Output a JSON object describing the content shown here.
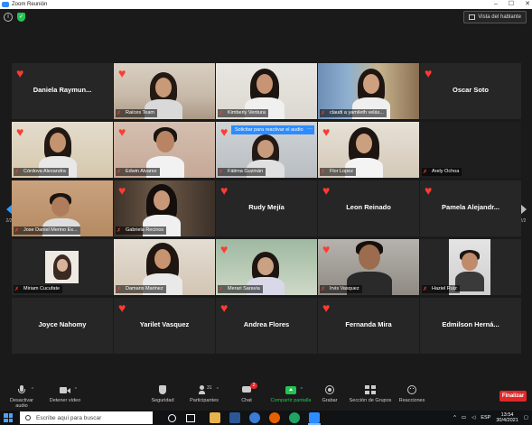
{
  "window": {
    "title": "Zoom Reunión",
    "minimize": "–",
    "maximize": "☐",
    "close": "✕"
  },
  "topbar": {
    "speaker_view_label": "Vista del hablante"
  },
  "nav": {
    "page_left": "2/2",
    "page_right": "2/2"
  },
  "tooltip": {
    "text": "Solicitar para reactivar el audio",
    "more": "···"
  },
  "tiles": [
    {
      "bigname": "Daniela  Raymun...",
      "label": ""
    },
    {
      "bigname": "",
      "label": "Raíces Team"
    },
    {
      "bigname": "",
      "label": "Kimberly Ventura"
    },
    {
      "bigname": "",
      "label": "claudi a yamileth velás..."
    },
    {
      "bigname": "Oscar Soto",
      "label": ""
    },
    {
      "bigname": "",
      "label": "Córdova Alexandra"
    },
    {
      "bigname": "",
      "label": "Edwin Alvarez"
    },
    {
      "bigname": "",
      "label": "Fátima Guzmán"
    },
    {
      "bigname": "",
      "label": "Flor Lopez"
    },
    {
      "bigname": "",
      "label": "Arely Ochoa"
    },
    {
      "bigname": "",
      "label": "Jose Daniel Merino Es..."
    },
    {
      "bigname": "",
      "label": "Gabriela Recinos"
    },
    {
      "bigname": "Rudy Mejía",
      "label": ""
    },
    {
      "bigname": "Leon Reinado",
      "label": ""
    },
    {
      "bigname": "Pamela  Alejandr...",
      "label": ""
    },
    {
      "bigname": "",
      "label": "Miriam Cucufate"
    },
    {
      "bigname": "",
      "label": "Damaris Marinez"
    },
    {
      "bigname": "",
      "label": "Merari Saravia"
    },
    {
      "bigname": "",
      "label": "Irvis Vasquez"
    },
    {
      "bigname": "",
      "label": "Haziel Ruiz"
    },
    {
      "bigname": "Joyce Nahomy",
      "label": ""
    },
    {
      "bigname": "Yarilet Vasquez",
      "label": ""
    },
    {
      "bigname": "Andrea Flores",
      "label": ""
    },
    {
      "bigname": "Fernanda Mira",
      "label": ""
    },
    {
      "bigname": "Edmilson  Herná...",
      "label": ""
    }
  ],
  "toolbar": {
    "mic": "Desactivar audio",
    "video": "Detener vídeo",
    "security": "Seguridad",
    "participants": "Participantes",
    "participants_count": "31",
    "chat": "Chat",
    "chat_badge": "2",
    "share": "Compartir pantalla",
    "record": "Grabar",
    "breakout": "Sección de Grupos",
    "reactions": "Reacciones",
    "end": "Finalizar"
  },
  "taskbar": {
    "search_placeholder": "Escribe aquí para buscar",
    "lang": "ESP",
    "time": "13:54",
    "date": "30/4/2021"
  },
  "colors": {
    "accent": "#2d8cff",
    "end_red": "#e02828",
    "heart": "#ff3b30",
    "tile_bg": "#262626"
  }
}
